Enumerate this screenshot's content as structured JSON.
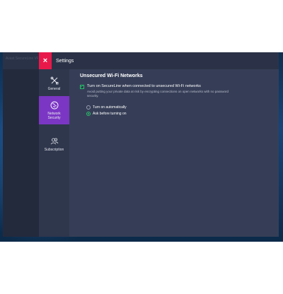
{
  "app": {
    "name": "Avast SecureLine VPN"
  },
  "header": {
    "title": "Settings",
    "close_glyph": "×"
  },
  "nav": {
    "items": [
      {
        "label": "General",
        "icon": "tools-icon"
      },
      {
        "label": "Network\nSecurity",
        "icon": "globe-icon",
        "active": true
      },
      {
        "label": "Subscription",
        "icon": "users-icon"
      }
    ]
  },
  "content": {
    "section_title": "Unsecured Wi-Fi Networks",
    "checkbox": {
      "checked": true,
      "label": "Turn on SecureLine when connected to unsecured Wi-Fi networks",
      "description": "Avoid putting your private data at risk by encrypting connections on open networks with no password security."
    },
    "radios": [
      {
        "label": "Turn on automatically",
        "checked": false
      },
      {
        "label": "Ask before turning on",
        "checked": true
      }
    ]
  },
  "colors": {
    "accent_red": "#e8194a",
    "active_nav": "#7b36c4",
    "green": "#28c06a"
  }
}
